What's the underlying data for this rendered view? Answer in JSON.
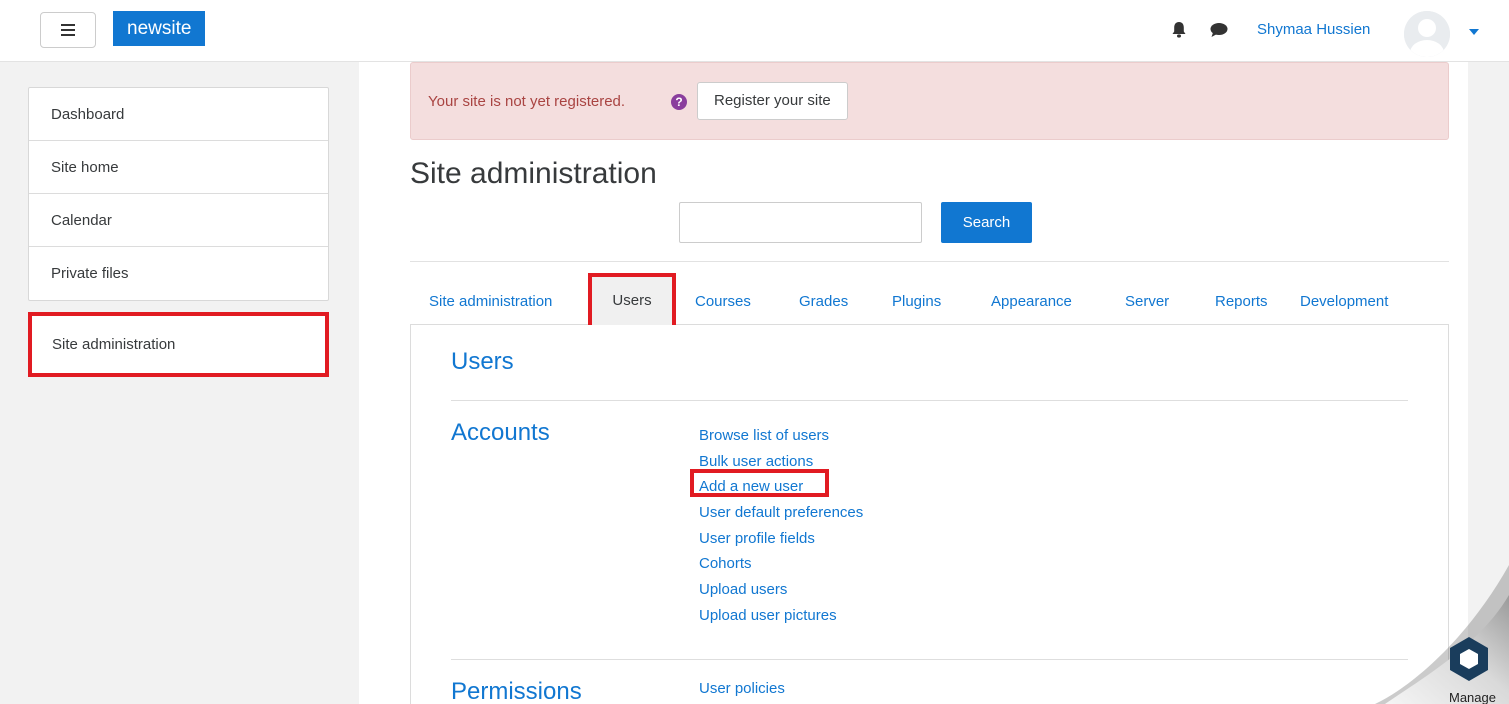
{
  "navbar": {
    "brand": "newsite",
    "username": "Shymaa Hussien"
  },
  "drawer": {
    "items": [
      {
        "label": "Dashboard"
      },
      {
        "label": "Site home"
      },
      {
        "label": "Calendar"
      },
      {
        "label": "Private files"
      }
    ],
    "admin_label": "Site administration"
  },
  "alert": {
    "text": "Your site is not yet registered.",
    "button": "Register your site"
  },
  "page": {
    "title": "Site administration",
    "search_button": "Search"
  },
  "tabs": [
    {
      "label": "Site administration"
    },
    {
      "label": "Users"
    },
    {
      "label": "Courses"
    },
    {
      "label": "Grades"
    },
    {
      "label": "Plugins"
    },
    {
      "label": "Appearance"
    },
    {
      "label": "Server"
    },
    {
      "label": "Reports"
    },
    {
      "label": "Development"
    }
  ],
  "content": {
    "users_heading": "Users",
    "accounts_heading": "Accounts",
    "accounts_links": [
      "Browse list of users",
      "Bulk user actions",
      "Add a new user",
      "User default preferences",
      "User profile fields",
      "Cohorts",
      "Upload users",
      "Upload user pictures"
    ],
    "permissions_heading": "Permissions",
    "permissions_first_link": "User policies"
  },
  "manage_label": "Manage",
  "colors": {
    "accent": "#1177d1",
    "highlight": "#e11b22",
    "alert_bg": "#f4dede",
    "alert_text": "#a94442"
  }
}
